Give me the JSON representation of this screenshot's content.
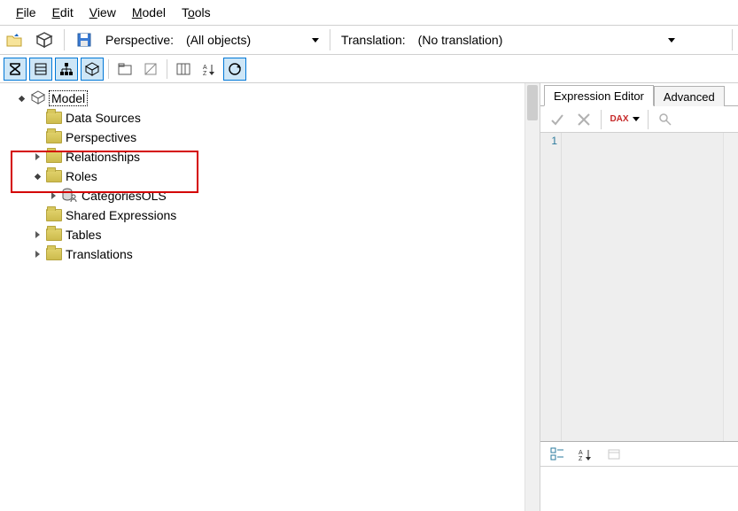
{
  "menubar": {
    "file": "File",
    "edit": "Edit",
    "view": "View",
    "model": "Model",
    "tools": "Tools"
  },
  "perspective": {
    "label": "Perspective:",
    "value": "(All objects)"
  },
  "translation": {
    "label": "Translation:",
    "value": "(No translation)"
  },
  "tree": {
    "root": "Model",
    "data_sources": "Data Sources",
    "perspectives": "Perspectives",
    "relationships": "Relationships",
    "roles": "Roles",
    "role_item": "CategoriesOLS",
    "shared_expressions": "Shared Expressions",
    "tables": "Tables",
    "translations": "Translations"
  },
  "right_panel": {
    "tab_expression": "Expression Editor",
    "tab_advanced": "Advanced",
    "dax_label": "DAX",
    "gutter_1": "1"
  }
}
